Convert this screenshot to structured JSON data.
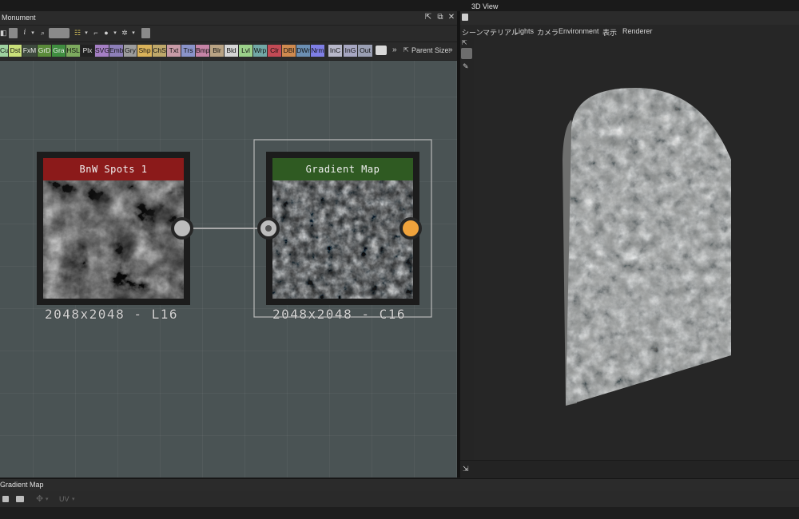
{
  "graph_panel": {
    "title": "Monument",
    "toolbar": {
      "info_label": "i"
    },
    "filters": [
      {
        "label": "Cur",
        "color": "#9fd3a0"
      },
      {
        "label": "Dst",
        "color": "#c9e07a"
      },
      {
        "label": "FxM",
        "color": "#3e4a3e"
      },
      {
        "label": "GrD",
        "color": "#5a8a3a"
      },
      {
        "label": "Gra",
        "color": "#3f8d3f"
      },
      {
        "label": "HSL",
        "color": "#7daa5e"
      },
      {
        "label": "Plx",
        "color": "#222222"
      },
      {
        "label": "SVG",
        "color": "#a57fc4"
      },
      {
        "label": "Emb",
        "color": "#8d7fb8"
      },
      {
        "label": "Gry",
        "color": "#9c9c9c"
      },
      {
        "label": "Shp",
        "color": "#d9b25a"
      },
      {
        "label": "ChS",
        "color": "#bfa86a"
      },
      {
        "label": "Txt",
        "color": "#c79aa6"
      },
      {
        "label": "Trs",
        "color": "#8a93c9"
      },
      {
        "label": "Bmp",
        "color": "#c684a6"
      },
      {
        "label": "Blr",
        "color": "#b9a384"
      },
      {
        "label": "Bld",
        "color": "#d6d6d6"
      },
      {
        "label": "Lvl",
        "color": "#9bd08a"
      },
      {
        "label": "Wrp",
        "color": "#72a8a6"
      },
      {
        "label": "Clr",
        "color": "#c24a55"
      },
      {
        "label": "DBl",
        "color": "#cf8a4f"
      },
      {
        "label": "DWr",
        "color": "#6c8fb3"
      },
      {
        "label": "Nrm",
        "color": "#7f7fe6"
      },
      {
        "label": "InC",
        "color": "#b7b7c9"
      },
      {
        "label": "InG",
        "color": "#a7a7c2"
      },
      {
        "label": "Out",
        "color": "#9a9fb3"
      }
    ],
    "more_label": "»",
    "parent_size_label": "Parent Size:",
    "more_label_2": "»",
    "nodes": [
      {
        "title": "BnW Spots 1",
        "header_color": "#8b1a1a",
        "resolution": "2048x2048 - L16"
      },
      {
        "title": "Gradient Map",
        "header_color": "#2f5a22",
        "resolution": "2048x2048 - C16"
      }
    ],
    "port_colors": {
      "output_gray": "#bdbdbd",
      "input": "#bdbdbd",
      "output_color": "#f0a33c"
    }
  },
  "view3d_panel": {
    "title": "3D View",
    "menu": [
      "シーン",
      "マテリアル",
      "Lights",
      "カメラ",
      "Environment",
      "表示",
      "Renderer"
    ]
  },
  "bottom_panel": {
    "title": "Gradient Map",
    "uv_label": "UV"
  },
  "colors": {
    "graph_background": "#4a5354",
    "panel_background": "#2a2a2a",
    "viewport_background": "#262626"
  }
}
